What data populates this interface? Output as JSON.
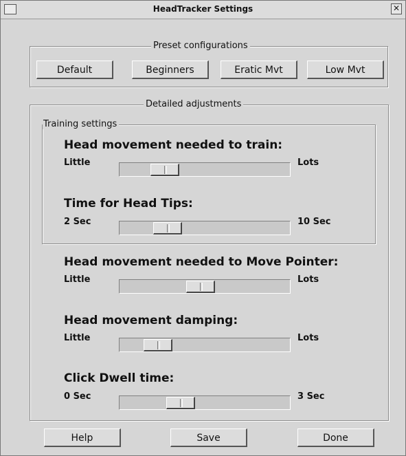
{
  "window": {
    "title": "HeadTracker Settings",
    "close_glyph": "✕"
  },
  "presets": {
    "legend": "Preset configurations",
    "buttons": [
      "Default",
      "Beginners",
      "Eratic Mvt",
      "Low Mvt"
    ]
  },
  "detailed": {
    "legend": "Detailed adjustments",
    "training_legend": "Training settings",
    "sliders": [
      {
        "heading": "Head movement needed to train:",
        "min_label": "Little",
        "max_label": "Lots",
        "level": 0.22
      },
      {
        "heading": "Time for Head Tips:",
        "min_label": "2 Sec",
        "max_label": "10 Sec",
        "level": 0.24
      },
      {
        "heading": "Head movement needed to Move Pointer:",
        "min_label": "Little",
        "max_label": "Lots",
        "level": 0.47
      },
      {
        "heading": "Head movement damping:",
        "min_label": "Little",
        "max_label": "Lots",
        "level": 0.17
      },
      {
        "heading": "Click Dwell time:",
        "min_label": "0 Sec",
        "max_label": "3 Sec",
        "level": 0.33
      }
    ]
  },
  "footer": {
    "buttons": [
      "Help",
      "Save",
      "Done"
    ]
  },
  "icons": {
    "window_menu": "window-menu-icon",
    "close": "close-icon"
  }
}
